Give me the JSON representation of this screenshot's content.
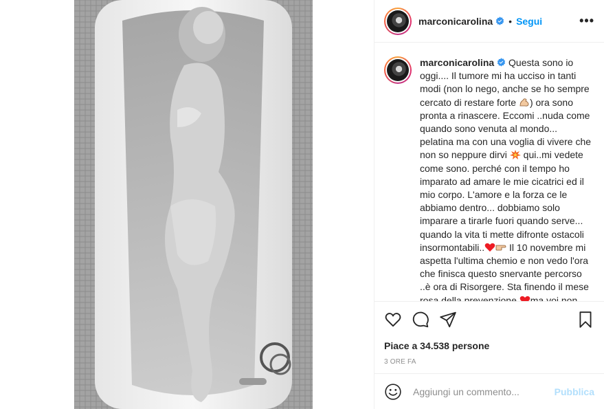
{
  "post": {
    "image_alt": "Foto in bianco e nero di una donna distesa in una vasca da bagno"
  },
  "header": {
    "username": "marconicarolina",
    "separator": "•",
    "follow_label": "Segui",
    "more_label": "•••"
  },
  "caption": {
    "username": "marconicarolina",
    "part1": " Questa sono io oggi.... Il tumore mi ha ucciso in tanti modi (non lo nego, anche se ho sempre cercato di restare forte ",
    "part2": ") ora sono pronta a rinascere. Eccomi ..nuda come quando sono venuta al mondo... pelatina ma con una voglia di vivere che non so neppure dirvi ",
    "part3": " qui..mi vedete come sono. perché con il tempo ho imparato ad amare le mie cicatrici ed il mio corpo. L'amore e la forza ce le abbiamo dentro... dobbiamo solo imparare a tirarle fuori quando serve... quando la vita ti mette difronte ostacoli insormontabili..",
    "part4": " Il 10 novembre mi aspetta l'ultima chemio e non vedo l'ora che finisca questo snervante percorso ..è ora di Risorgere. Sta finendo il mese rosa della prevenzione ",
    "part5": "ma voi non dobbiamo tramidere per dire. Continuate"
  },
  "icons": {
    "verified": "verified-badge-icon",
    "like": "heart-icon",
    "comment": "comment-icon",
    "share": "paper-plane-icon",
    "save": "bookmark-icon",
    "emoji": "smiley-icon"
  },
  "stats": {
    "likes": "Piace a 34.538 persone",
    "time": "3 ORE FA"
  },
  "comment": {
    "placeholder": "Aggiungi un commento...",
    "publish_label": "Pubblica"
  },
  "colors": {
    "accent": "#0095f6",
    "publish_disabled": "#b2dffc",
    "heart": "#ed1c24",
    "verified": "#3897f0"
  }
}
